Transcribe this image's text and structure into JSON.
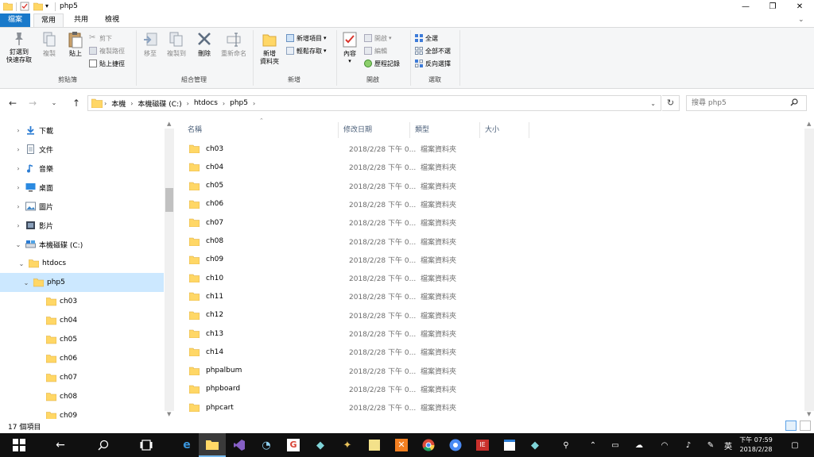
{
  "window": {
    "title": "php5",
    "controls": {
      "minimize": "—",
      "maximize": "❐",
      "close": "✕"
    }
  },
  "ribbon_tabs": [
    "檔案",
    "常用",
    "共用",
    "檢視"
  ],
  "ribbon": {
    "clipboard": {
      "label": "剪貼簿",
      "pin": "釘選到\n快速存取",
      "copy": "複製",
      "paste": "貼上",
      "cut": "剪下",
      "copy_path": "複製路徑",
      "paste_shortcut": "貼上捷徑"
    },
    "organize": {
      "label": "組合管理",
      "move_to": "移至",
      "copy_to": "複製到",
      "delete": "刪除",
      "rename": "重新命名"
    },
    "new": {
      "label": "新增",
      "new_folder": "新增\n資料夾",
      "new_item": "新增項目",
      "easy_access": "輕鬆存取"
    },
    "open": {
      "label": "開啟",
      "properties": "內容",
      "open": "開啟",
      "edit": "編輯",
      "history": "歷程記錄"
    },
    "select": {
      "label": "選取",
      "select_all": "全選",
      "select_none": "全部不選",
      "invert": "反向選擇"
    }
  },
  "address": {
    "crumbs": [
      "本機",
      "本機磁碟 (C:)",
      "htdocs",
      "php5"
    ],
    "search_placeholder": "搜尋 php5"
  },
  "nav_tree": [
    {
      "label": "下載",
      "icon": "download-icon",
      "level": 1,
      "expanded": false,
      "selected": false
    },
    {
      "label": "文件",
      "icon": "document-icon",
      "level": 1,
      "expanded": false,
      "selected": false
    },
    {
      "label": "音樂",
      "icon": "music-icon",
      "level": 1,
      "expanded": false,
      "selected": false
    },
    {
      "label": "桌面",
      "icon": "desktop-icon",
      "level": 1,
      "expanded": false,
      "selected": false
    },
    {
      "label": "圖片",
      "icon": "pictures-icon",
      "level": 1,
      "expanded": false,
      "selected": false
    },
    {
      "label": "影片",
      "icon": "video-icon",
      "level": 1,
      "expanded": false,
      "selected": false
    },
    {
      "label": "本機磁碟 (C:)",
      "icon": "drive-icon",
      "level": 1,
      "expanded": true,
      "selected": false
    },
    {
      "label": "htdocs",
      "icon": "folder-icon",
      "level": 2,
      "expanded": true,
      "selected": false
    },
    {
      "label": "php5",
      "icon": "folder-icon",
      "level": 3,
      "expanded": true,
      "selected": true
    },
    {
      "label": "ch03",
      "icon": "folder-icon",
      "level": 4,
      "expanded": null,
      "selected": false
    },
    {
      "label": "ch04",
      "icon": "folder-icon",
      "level": 4,
      "expanded": null,
      "selected": false
    },
    {
      "label": "ch05",
      "icon": "folder-icon",
      "level": 4,
      "expanded": null,
      "selected": false
    },
    {
      "label": "ch06",
      "icon": "folder-icon",
      "level": 4,
      "expanded": null,
      "selected": false
    },
    {
      "label": "ch07",
      "icon": "folder-icon",
      "level": 4,
      "expanded": null,
      "selected": false
    },
    {
      "label": "ch08",
      "icon": "folder-icon",
      "level": 4,
      "expanded": null,
      "selected": false
    },
    {
      "label": "ch09",
      "icon": "folder-icon",
      "level": 4,
      "expanded": null,
      "selected": false
    }
  ],
  "columns": {
    "name": "名稱",
    "date": "修改日期",
    "type": "類型",
    "size": "大小"
  },
  "files": [
    {
      "name": "ch03",
      "date": "2018/2/28 下午 0...",
      "type": "檔案資料夾"
    },
    {
      "name": "ch04",
      "date": "2018/2/28 下午 0...",
      "type": "檔案資料夾"
    },
    {
      "name": "ch05",
      "date": "2018/2/28 下午 0...",
      "type": "檔案資料夾"
    },
    {
      "name": "ch06",
      "date": "2018/2/28 下午 0...",
      "type": "檔案資料夾"
    },
    {
      "name": "ch07",
      "date": "2018/2/28 下午 0...",
      "type": "檔案資料夾"
    },
    {
      "name": "ch08",
      "date": "2018/2/28 下午 0...",
      "type": "檔案資料夾"
    },
    {
      "name": "ch09",
      "date": "2018/2/28 下午 0...",
      "type": "檔案資料夾"
    },
    {
      "name": "ch10",
      "date": "2018/2/28 下午 0...",
      "type": "檔案資料夾"
    },
    {
      "name": "ch11",
      "date": "2018/2/28 下午 0...",
      "type": "檔案資料夾"
    },
    {
      "name": "ch12",
      "date": "2018/2/28 下午 0...",
      "type": "檔案資料夾"
    },
    {
      "name": "ch13",
      "date": "2018/2/28 下午 0...",
      "type": "檔案資料夾"
    },
    {
      "name": "ch14",
      "date": "2018/2/28 下午 0...",
      "type": "檔案資料夾"
    },
    {
      "name": "phpalbum",
      "date": "2018/2/28 下午 0...",
      "type": "檔案資料夾"
    },
    {
      "name": "phpboard",
      "date": "2018/2/28 下午 0...",
      "type": "檔案資料夾"
    },
    {
      "name": "phpcart",
      "date": "2018/2/28 下午 0...",
      "type": "檔案資料夾"
    }
  ],
  "status": {
    "count": "17 個項目"
  },
  "taskbar": {
    "apps": [
      "start-icon",
      "back-icon",
      "search-icon",
      "task-view-icon",
      "edge-icon",
      "file-explorer-icon",
      "visual-studio-icon",
      "app-icon",
      "google-icon",
      "app2-icon",
      "app3-icon",
      "notes-icon",
      "xampp-icon",
      "chrome-icon",
      "chrome-alt-icon",
      "app4-icon",
      "app5-icon",
      "app6-icon"
    ],
    "ime": "英",
    "time": "下午 07:59",
    "date": "2018/2/28"
  },
  "colors": {
    "file_tab": "#1979ca",
    "selection": "#cce8ff",
    "folder": "#ffd766",
    "taskbar": "#101010"
  }
}
